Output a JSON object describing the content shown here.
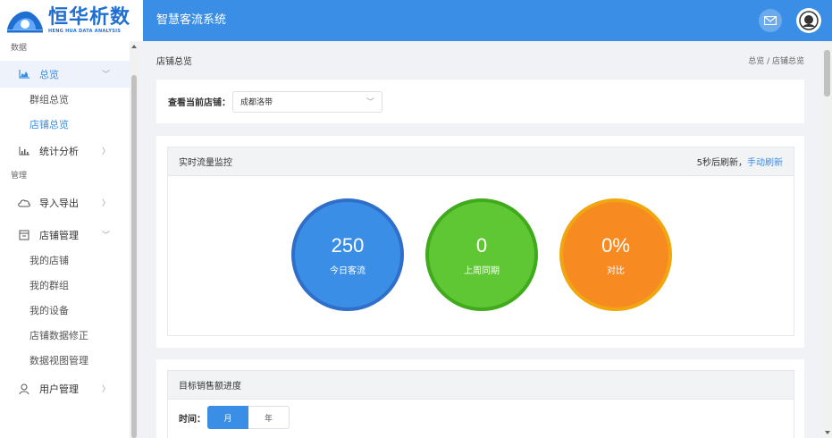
{
  "brand": {
    "logo_text": "恒华析数",
    "logo_sub": "HENG HUA DATA ANALYSIS",
    "app_title": "智慧客流系统",
    "accent": "#3a8ee6"
  },
  "header": {
    "icons": [
      "mail-icon",
      "avatar-icon"
    ]
  },
  "sidebar": {
    "groups": [
      {
        "title": "数据"
      },
      {
        "title": "管理"
      }
    ],
    "items": [
      {
        "label": "总览",
        "icon": "chart-area-icon",
        "expanded": true,
        "active": true,
        "children": [
          {
            "label": "群组总览"
          },
          {
            "label": "店铺总览",
            "active": true
          }
        ]
      },
      {
        "label": "统计分析",
        "icon": "bar-chart-icon",
        "expanded": false
      },
      {
        "label": "导入导出",
        "icon": "cloud-icon",
        "expanded": false
      },
      {
        "label": "店铺管理",
        "icon": "store-icon",
        "expanded": true,
        "children": [
          {
            "label": "我的店铺"
          },
          {
            "label": "我的群组"
          },
          {
            "label": "我的设备"
          },
          {
            "label": "店铺数据修正"
          },
          {
            "label": "数据视图管理"
          }
        ]
      },
      {
        "label": "用户管理",
        "icon": "user-icon",
        "expanded": false
      }
    ]
  },
  "breadcrumb": {
    "title": "店铺总览",
    "path": "总览 / 店铺总览"
  },
  "store_select": {
    "label": "查看当前店铺：",
    "value": "成都洛带"
  },
  "realtime": {
    "title": "实时流量监控",
    "refresh_text": "5秒后刷新，",
    "refresh_link": "手动刷新",
    "stats": [
      {
        "value": "250",
        "caption": "今日客流",
        "color": "#3a8ee6"
      },
      {
        "value": "0",
        "caption": "上周同期",
        "color": "#5fc733"
      },
      {
        "value": "0%",
        "caption": "对比",
        "color": "#f78b22"
      }
    ]
  },
  "target": {
    "title": "目标销售额进度",
    "time_label": "时间：",
    "options": [
      "月",
      "年"
    ],
    "selected": "月"
  }
}
